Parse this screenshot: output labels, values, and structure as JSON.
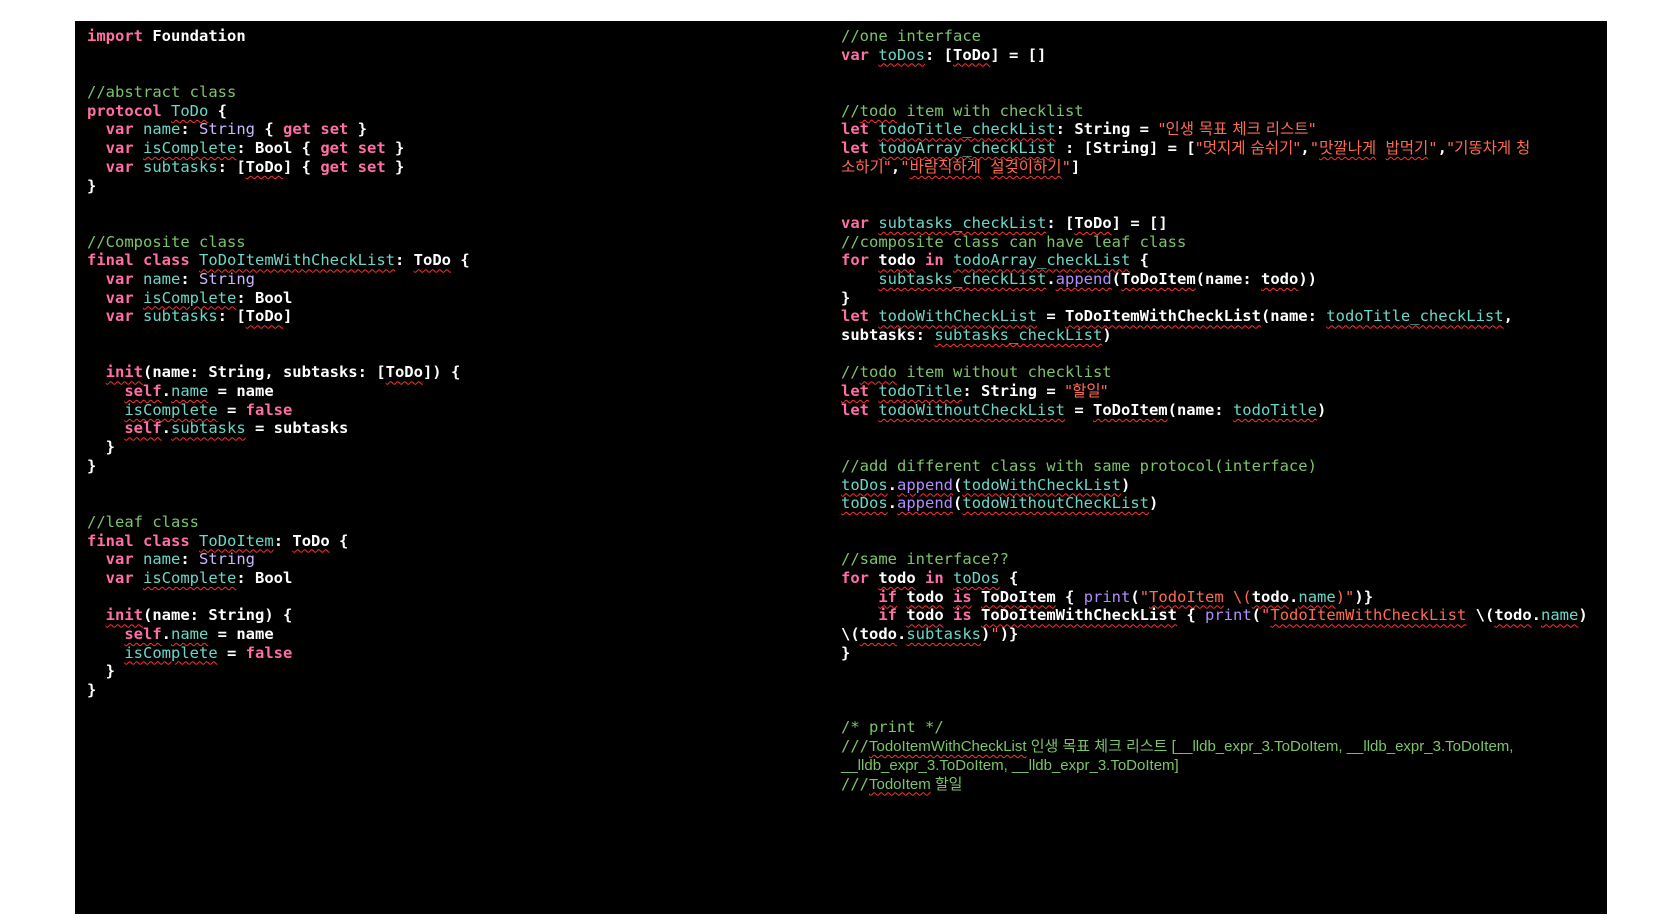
{
  "theme": {
    "background": "#000000",
    "page_background": "#ffffff",
    "colors": {
      "default": "#ffffff",
      "kw": "#ff6fa6",
      "cm": "#7cc46a",
      "ty": "#c9b8ff",
      "id": "#6ad7c8",
      "st": "#ff6a52",
      "fn": "#b38cff",
      "squiggle": "#ff3030"
    }
  },
  "editor": {
    "left_column": [
      [
        {
          "t": "import",
          "c": "kw"
        },
        {
          "t": " Foundation"
        }
      ],
      [],
      [],
      [
        {
          "t": "//abstract class",
          "c": "cm"
        }
      ],
      [
        {
          "t": "protocol",
          "c": "kw"
        },
        {
          "t": " "
        },
        {
          "t": "ToDo",
          "c": "id",
          "sq": true
        },
        {
          "t": " {"
        }
      ],
      [
        {
          "t": "  "
        },
        {
          "t": "var",
          "c": "kw"
        },
        {
          "t": " "
        },
        {
          "t": "name",
          "c": "id"
        },
        {
          "t": ": "
        },
        {
          "t": "String",
          "c": "ty"
        },
        {
          "t": " { "
        },
        {
          "t": "get",
          "c": "kw"
        },
        {
          "t": " "
        },
        {
          "t": "set",
          "c": "kw"
        },
        {
          "t": " }"
        }
      ],
      [
        {
          "t": "  "
        },
        {
          "t": "var",
          "c": "kw"
        },
        {
          "t": " "
        },
        {
          "t": "isComplete",
          "c": "id",
          "sq": true
        },
        {
          "t": ": Bool { "
        },
        {
          "t": "get",
          "c": "kw"
        },
        {
          "t": " "
        },
        {
          "t": "set",
          "c": "kw"
        },
        {
          "t": " }"
        }
      ],
      [
        {
          "t": "  "
        },
        {
          "t": "var",
          "c": "kw"
        },
        {
          "t": " "
        },
        {
          "t": "subtasks",
          "c": "id"
        },
        {
          "t": ": ["
        },
        {
          "t": "ToDo",
          "c": "",
          "sq": true
        },
        {
          "t": "] { "
        },
        {
          "t": "get",
          "c": "kw"
        },
        {
          "t": " "
        },
        {
          "t": "set",
          "c": "kw"
        },
        {
          "t": " }"
        }
      ],
      [
        {
          "t": "}"
        }
      ],
      [],
      [],
      [
        {
          "t": "//Composite class",
          "c": "cm"
        }
      ],
      [
        {
          "t": "final",
          "c": "kw"
        },
        {
          "t": " "
        },
        {
          "t": "class",
          "c": "kw"
        },
        {
          "t": " "
        },
        {
          "t": "ToDoItemWithCheckList",
          "c": "id",
          "sq": true
        },
        {
          "t": ": "
        },
        {
          "t": "ToDo",
          "c": "",
          "sq": true
        },
        {
          "t": " {"
        }
      ],
      [
        {
          "t": "  "
        },
        {
          "t": "var",
          "c": "kw"
        },
        {
          "t": " "
        },
        {
          "t": "name",
          "c": "id"
        },
        {
          "t": ": "
        },
        {
          "t": "String",
          "c": "ty"
        }
      ],
      [
        {
          "t": "  "
        },
        {
          "t": "var",
          "c": "kw"
        },
        {
          "t": " "
        },
        {
          "t": "isComplete",
          "c": "id",
          "sq": true
        },
        {
          "t": ": Bool"
        }
      ],
      [
        {
          "t": "  "
        },
        {
          "t": "var",
          "c": "kw"
        },
        {
          "t": " "
        },
        {
          "t": "subtasks",
          "c": "id"
        },
        {
          "t": ": ["
        },
        {
          "t": "ToDo",
          "c": "",
          "sq": true
        },
        {
          "t": "]"
        }
      ],
      [],
      [],
      [
        {
          "t": "  "
        },
        {
          "t": "init",
          "c": "kw",
          "sq": true
        },
        {
          "t": "(name: String, subtasks: ["
        },
        {
          "t": "ToDo",
          "c": "",
          "sq": true
        },
        {
          "t": "]) {"
        }
      ],
      [
        {
          "t": "    "
        },
        {
          "t": "self",
          "c": "kw",
          "sq": true
        },
        {
          "t": "."
        },
        {
          "t": "name",
          "c": "id",
          "sq": true
        },
        {
          "t": " = name"
        }
      ],
      [
        {
          "t": "    "
        },
        {
          "t": "isComplete",
          "c": "id",
          "sq": true
        },
        {
          "t": " = "
        },
        {
          "t": "false",
          "c": "kw"
        }
      ],
      [
        {
          "t": "    "
        },
        {
          "t": "self",
          "c": "kw",
          "sq": true
        },
        {
          "t": "."
        },
        {
          "t": "subtasks",
          "c": "id",
          "sq": true
        },
        {
          "t": " = subtasks"
        }
      ],
      [
        {
          "t": "  }"
        }
      ],
      [
        {
          "t": "}"
        }
      ],
      [],
      [],
      [
        {
          "t": "//leaf class",
          "c": "cm"
        }
      ],
      [
        {
          "t": "final",
          "c": "kw"
        },
        {
          "t": " "
        },
        {
          "t": "class",
          "c": "kw"
        },
        {
          "t": " "
        },
        {
          "t": "ToDoItem",
          "c": "id",
          "sq": true
        },
        {
          "t": ": "
        },
        {
          "t": "ToDo",
          "c": "",
          "sq": true
        },
        {
          "t": " {"
        }
      ],
      [
        {
          "t": "  "
        },
        {
          "t": "var",
          "c": "kw"
        },
        {
          "t": " "
        },
        {
          "t": "name",
          "c": "id"
        },
        {
          "t": ": "
        },
        {
          "t": "String",
          "c": "ty"
        }
      ],
      [
        {
          "t": "  "
        },
        {
          "t": "var",
          "c": "kw"
        },
        {
          "t": " "
        },
        {
          "t": "isComplete",
          "c": "id",
          "sq": true
        },
        {
          "t": ": Bool"
        }
      ],
      [],
      [
        {
          "t": "  "
        },
        {
          "t": "init",
          "c": "kw",
          "sq": true
        },
        {
          "t": "(name: String) {"
        }
      ],
      [
        {
          "t": "    "
        },
        {
          "t": "self",
          "c": "kw",
          "sq": true
        },
        {
          "t": "."
        },
        {
          "t": "name",
          "c": "id",
          "sq": true
        },
        {
          "t": " = name"
        }
      ],
      [
        {
          "t": "    "
        },
        {
          "t": "isComplete",
          "c": "id",
          "sq": true
        },
        {
          "t": " = "
        },
        {
          "t": "false",
          "c": "kw"
        }
      ],
      [
        {
          "t": "  }"
        }
      ],
      [
        {
          "t": "}"
        }
      ]
    ],
    "right_column": [
      [
        {
          "t": "//one interface",
          "c": "cm"
        }
      ],
      [
        {
          "t": "var",
          "c": "kw"
        },
        {
          "t": " "
        },
        {
          "t": "toDos",
          "c": "id",
          "sq": true
        },
        {
          "t": ": ["
        },
        {
          "t": "ToDo",
          "c": "",
          "sq": true
        },
        {
          "t": "] = []"
        }
      ],
      [],
      [],
      [
        {
          "t": "//",
          "c": "cm"
        },
        {
          "t": "todo",
          "c": "cm",
          "sq": true
        },
        {
          "t": " item with checklist",
          "c": "cm"
        }
      ],
      [
        {
          "t": "let",
          "c": "kw"
        },
        {
          "t": " "
        },
        {
          "t": "todoTitle_checkList",
          "c": "id",
          "sq": true
        },
        {
          "t": ": String = "
        },
        {
          "t": "\"인생 목표 체크 리스트\"",
          "c": "st",
          "ko": true
        }
      ],
      [
        {
          "t": "let",
          "c": "kw"
        },
        {
          "t": " "
        },
        {
          "t": "todoArray_checkList",
          "c": "id",
          "sq": true
        },
        {
          "t": " : [String] = ["
        },
        {
          "t": "\"멋지게 숨쉬기\"",
          "c": "st",
          "ko": true
        },
        {
          "t": ","
        },
        {
          "t": "\"",
          "c": "st"
        },
        {
          "t": "맛깔나게",
          "c": "st",
          "sq": true,
          "ko": true
        },
        {
          "t": " ",
          "c": "st"
        },
        {
          "t": "밥먹기",
          "c": "st",
          "sq": true,
          "ko": true
        },
        {
          "t": "\"",
          "c": "st"
        },
        {
          "t": ","
        },
        {
          "t": "\"기똥차게 청",
          "c": "st",
          "ko": true
        }
      ],
      [
        {
          "t": "소하기\"",
          "c": "st",
          "ko": true
        },
        {
          "t": ","
        },
        {
          "t": "\"",
          "c": "st"
        },
        {
          "t": "바람직하게",
          "c": "st",
          "sq": true,
          "ko": true
        },
        {
          "t": " ",
          "c": "st"
        },
        {
          "t": "설겆이하기",
          "c": "st",
          "sq": true,
          "ko": true
        },
        {
          "t": "\"",
          "c": "st"
        },
        {
          "t": "]"
        }
      ],
      [],
      [],
      [
        {
          "t": "var",
          "c": "kw"
        },
        {
          "t": " "
        },
        {
          "t": "subtasks_checkList",
          "c": "id",
          "sq": true
        },
        {
          "t": ": ["
        },
        {
          "t": "ToDo",
          "c": "",
          "sq": true
        },
        {
          "t": "] = []"
        }
      ],
      [
        {
          "t": "//composite class can have leaf class",
          "c": "cm"
        }
      ],
      [
        {
          "t": "for",
          "c": "kw"
        },
        {
          "t": " "
        },
        {
          "t": "todo",
          "c": "",
          "sq": true
        },
        {
          "t": " "
        },
        {
          "t": "in",
          "c": "kw"
        },
        {
          "t": " "
        },
        {
          "t": "todoArray_checkList",
          "c": "id",
          "sq": true
        },
        {
          "t": " {"
        }
      ],
      [
        {
          "t": "    "
        },
        {
          "t": "subtasks_checkList",
          "c": "id",
          "sq": true
        },
        {
          "t": "."
        },
        {
          "t": "append",
          "c": "fn",
          "sq": true
        },
        {
          "t": "("
        },
        {
          "t": "ToDoItem",
          "c": "",
          "sq": true
        },
        {
          "t": "(name: "
        },
        {
          "t": "todo",
          "c": "",
          "sq": true
        },
        {
          "t": "))"
        }
      ],
      [
        {
          "t": "}"
        }
      ],
      [
        {
          "t": "let",
          "c": "kw"
        },
        {
          "t": " "
        },
        {
          "t": "todoWithCheckList",
          "c": "id",
          "sq": true
        },
        {
          "t": " = "
        },
        {
          "t": "ToDoItemWithCheckList",
          "c": "",
          "sq": true
        },
        {
          "t": "(name: "
        },
        {
          "t": "todoTitle_checkList",
          "c": "id",
          "sq": true
        },
        {
          "t": ","
        }
      ],
      [
        {
          "t": "subtasks: "
        },
        {
          "t": "subtasks_checkList",
          "c": "id",
          "sq": true
        },
        {
          "t": ")"
        }
      ],
      [],
      [
        {
          "t": "//",
          "c": "cm"
        },
        {
          "t": "todo",
          "c": "cm",
          "sq": true
        },
        {
          "t": " item without checklist",
          "c": "cm"
        }
      ],
      [
        {
          "t": "let",
          "c": "kw",
          "sq": true
        },
        {
          "t": " "
        },
        {
          "t": "todoTitle",
          "c": "id",
          "sq": true
        },
        {
          "t": ": String = "
        },
        {
          "t": "\"할일\"",
          "c": "st",
          "ko": true
        }
      ],
      [
        {
          "t": "let",
          "c": "kw"
        },
        {
          "t": " "
        },
        {
          "t": "todoWithoutCheckList",
          "c": "id",
          "sq": true
        },
        {
          "t": " = "
        },
        {
          "t": "ToDoItem",
          "c": "",
          "sq": true
        },
        {
          "t": "(name: "
        },
        {
          "t": "todoTitle",
          "c": "id",
          "sq": true
        },
        {
          "t": ")"
        }
      ],
      [],
      [],
      [
        {
          "t": "//add different class with same protocol(interface)",
          "c": "cm"
        }
      ],
      [
        {
          "t": "toDos",
          "c": "id",
          "sq": true
        },
        {
          "t": "."
        },
        {
          "t": "append",
          "c": "fn",
          "sq": true
        },
        {
          "t": "("
        },
        {
          "t": "todoWithCheckList",
          "c": "id",
          "sq": true
        },
        {
          "t": ")"
        }
      ],
      [
        {
          "t": "toDos",
          "c": "id",
          "sq": true
        },
        {
          "t": "."
        },
        {
          "t": "append",
          "c": "fn",
          "sq": true
        },
        {
          "t": "("
        },
        {
          "t": "todoWithoutCheckList",
          "c": "id",
          "sq": true
        },
        {
          "t": ")"
        }
      ],
      [],
      [],
      [
        {
          "t": "//same interface??",
          "c": "cm"
        }
      ],
      [
        {
          "t": "for",
          "c": "kw"
        },
        {
          "t": " "
        },
        {
          "t": "todo",
          "c": "",
          "sq": true
        },
        {
          "t": " "
        },
        {
          "t": "in",
          "c": "kw"
        },
        {
          "t": " "
        },
        {
          "t": "toDos",
          "c": "id",
          "sq": true
        },
        {
          "t": " {"
        }
      ],
      [
        {
          "t": "    "
        },
        {
          "t": "if",
          "c": "kw",
          "sq": true
        },
        {
          "t": " "
        },
        {
          "t": "todo",
          "c": "",
          "sq": true
        },
        {
          "t": " "
        },
        {
          "t": "is",
          "c": "kw",
          "sq": true
        },
        {
          "t": " "
        },
        {
          "t": "ToDoItem",
          "c": "",
          "sq": true
        },
        {
          "t": " { "
        },
        {
          "t": "print",
          "c": "fn"
        },
        {
          "t": "("
        },
        {
          "t": "\"",
          "c": "st"
        },
        {
          "t": "TodoItem",
          "c": "st",
          "sq": true
        },
        {
          "t": " \\(",
          "c": "st"
        },
        {
          "t": "todo",
          "c": "",
          "sq": true
        },
        {
          "t": "."
        },
        {
          "t": "name",
          "c": "id",
          "sq": true
        },
        {
          "t": ")",
          "c": "st"
        },
        {
          "t": "\"",
          "c": "st"
        },
        {
          "t": ")}"
        }
      ],
      [
        {
          "t": "    "
        },
        {
          "t": "if",
          "c": "kw"
        },
        {
          "t": " "
        },
        {
          "t": "todo",
          "c": "",
          "sq": true
        },
        {
          "t": " "
        },
        {
          "t": "is",
          "c": "kw"
        },
        {
          "t": " "
        },
        {
          "t": "ToDoItemWithCheckList",
          "c": "",
          "sq": true
        },
        {
          "t": " { "
        },
        {
          "t": "print",
          "c": "fn"
        },
        {
          "t": "("
        },
        {
          "t": "\"",
          "c": "st"
        },
        {
          "t": "TodoItemWithCheckList",
          "c": "st",
          "sq": true
        },
        {
          "t": " \\("
        },
        {
          "t": "todo",
          "c": "",
          "sq": true
        },
        {
          "t": "."
        },
        {
          "t": "name",
          "c": "id",
          "sq": true
        },
        {
          "t": ")"
        }
      ],
      [
        {
          "t": "\\("
        },
        {
          "t": "todo",
          "c": "",
          "sq": true
        },
        {
          "t": "."
        },
        {
          "t": "subtasks",
          "c": "id",
          "sq": true
        },
        {
          "t": ")"
        },
        {
          "t": "\"",
          "c": "st"
        },
        {
          "t": ")}"
        }
      ],
      [
        {
          "t": "}"
        }
      ],
      [],
      [],
      [],
      [
        {
          "t": "/* print */",
          "c": "cm"
        }
      ],
      [
        {
          "t": "///",
          "c": "cm"
        },
        {
          "t": "TodoItemWithCheckList",
          "c": "cm",
          "sq": true,
          "pl": true
        },
        {
          "t": " 인생 목표 체크 리스트 [__lldb_expr_3.ToDoItem, __lldb_expr_3.ToDoItem,",
          "c": "cm",
          "pl": true
        }
      ],
      [
        {
          "t": "__lldb_expr_3.ToDoItem, __lldb_expr_3.ToDoItem]",
          "c": "cm",
          "pl": true
        }
      ],
      [
        {
          "t": "///",
          "c": "cm"
        },
        {
          "t": "TodoItem",
          "c": "cm",
          "sq": true,
          "pl": true
        },
        {
          "t": " 할일",
          "c": "cm",
          "pl": true
        }
      ]
    ]
  }
}
